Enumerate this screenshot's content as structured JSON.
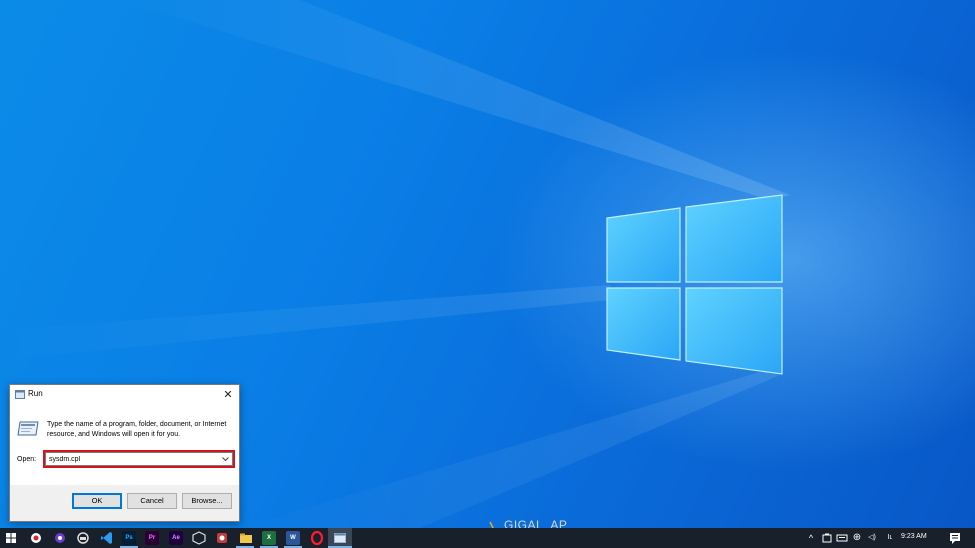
{
  "dialog": {
    "title": "Run",
    "close_glyph": "✕",
    "description": "Type the name of a program, folder, document, or Internet resource, and Windows will open it for you.",
    "open_label": "Open:",
    "open_value": "sysdm.cpl",
    "buttons": {
      "ok": "OK",
      "cancel": "Cancel",
      "browse": "Browse..."
    },
    "highlight_color": "#d4141c"
  },
  "taskbar": {
    "clock": "9:23 AM",
    "app_glyphs": {
      "photoshop": "Ps",
      "premiere": "Pr",
      "after_effects": "Ae",
      "excel": "X",
      "word": "W"
    },
    "ime_glyph": "Iʟ",
    "show_hidden_glyph": "^",
    "tray_glyphs": {
      "network": "⊕",
      "volume": "◁)"
    }
  },
  "watermark": {
    "text": "GIGAL_AP"
  },
  "colors": {
    "taskbar_bg": "#17202b",
    "accent": "#0078d7",
    "wallpaper_mid": "#0a7fe6"
  }
}
